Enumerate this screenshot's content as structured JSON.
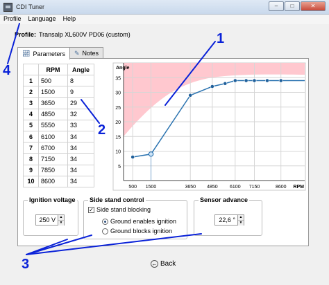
{
  "window": {
    "title": "CDI Tuner",
    "buttons": [
      "–",
      "□",
      "✕"
    ]
  },
  "menu": {
    "items": [
      "Profile",
      "Language",
      "Help"
    ]
  },
  "profile": {
    "label": "Profile:",
    "value": "Transalp XL600V PD06 (custom)"
  },
  "tabs": [
    {
      "label": "Parameters",
      "icon": "chart-icon"
    },
    {
      "label": "Notes",
      "icon": "notes-icon"
    }
  ],
  "table": {
    "headers": [
      "",
      "RPM",
      "Angle"
    ],
    "rows": [
      [
        "1",
        "500",
        "8"
      ],
      [
        "2",
        "1500",
        "9"
      ],
      [
        "3",
        "3650",
        "29"
      ],
      [
        "4",
        "4850",
        "32"
      ],
      [
        "5",
        "5550",
        "33"
      ],
      [
        "6",
        "6100",
        "34"
      ],
      [
        "7",
        "6700",
        "34"
      ],
      [
        "8",
        "7150",
        "34"
      ],
      [
        "9",
        "7850",
        "34"
      ],
      [
        "10",
        "8600",
        "34"
      ]
    ]
  },
  "chart_data": {
    "type": "line",
    "ylabel": "Angle",
    "xlabel": "RPM",
    "x": [
      500,
      1500,
      3650,
      4850,
      5550,
      6100,
      6700,
      7150,
      7850,
      8600
    ],
    "y": [
      8,
      9,
      29,
      32,
      33,
      34,
      34,
      34,
      34,
      34
    ],
    "y_ticks": [
      5,
      10,
      15,
      20,
      25,
      30,
      35
    ],
    "x_tick_labels": [
      "500",
      "1500",
      "3650",
      "4850",
      "6100",
      "7150",
      "8600"
    ],
    "x_tick_values": [
      500,
      1500,
      3650,
      4850,
      6100,
      7150,
      8600
    ],
    "xlim": [
      0,
      9900
    ],
    "ylim": [
      0,
      40
    ],
    "grid": true,
    "colors": {
      "line": "#2a73b0",
      "point": "#1f5f9a",
      "region": "#ffc8cf"
    }
  },
  "ignition_voltage": {
    "title": "Ignition voltage",
    "value": "250 V"
  },
  "side_stand": {
    "title": "Side stand control",
    "checkbox_label": "Side stand blocking",
    "checked": true,
    "options": [
      "Ground enables ignition",
      "Ground blocks ignition"
    ],
    "selected": 0
  },
  "sensor_advance": {
    "title": "Sensor advance",
    "value": "22,6 °"
  },
  "back_button": {
    "label": "Back"
  },
  "annotations": {
    "labels": [
      "1",
      "2",
      "3",
      "4"
    ],
    "color": "#0a22d8"
  }
}
